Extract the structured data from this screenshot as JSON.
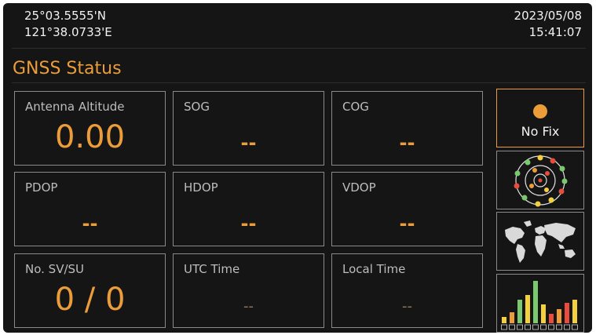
{
  "position": {
    "latitude": "25°03.5555'N",
    "longitude": "121°38.0733'E"
  },
  "clock": {
    "date": "2023/05/08",
    "time": "15:41:07"
  },
  "page": {
    "title": "GNSS Status"
  },
  "tiles": [
    {
      "label": "Antenna Altitude",
      "value": "0.00"
    },
    {
      "label": "SOG",
      "value": "--"
    },
    {
      "label": "COG",
      "value": "--"
    },
    {
      "label": "PDOP",
      "value": "--"
    },
    {
      "label": "HDOP",
      "value": "--"
    },
    {
      "label": "VDOP",
      "value": "--"
    },
    {
      "label": "No. SV/SU",
      "value": "0 / 0"
    },
    {
      "label": "UTC Time",
      "value": "--"
    },
    {
      "label": "Local Time",
      "value": "--"
    }
  ],
  "side_buttons": [
    {
      "label": "No Fix",
      "icon": "fix-status-dot-icon"
    },
    {
      "icon": "satellite-skyplot-icon"
    },
    {
      "icon": "world-map-icon"
    },
    {
      "icon": "signal-strength-bars-icon"
    }
  ],
  "colors": {
    "accent": "#ec9d3a",
    "background": "#151515",
    "border": "#8a8a8a",
    "text": "#f2f2f2"
  }
}
